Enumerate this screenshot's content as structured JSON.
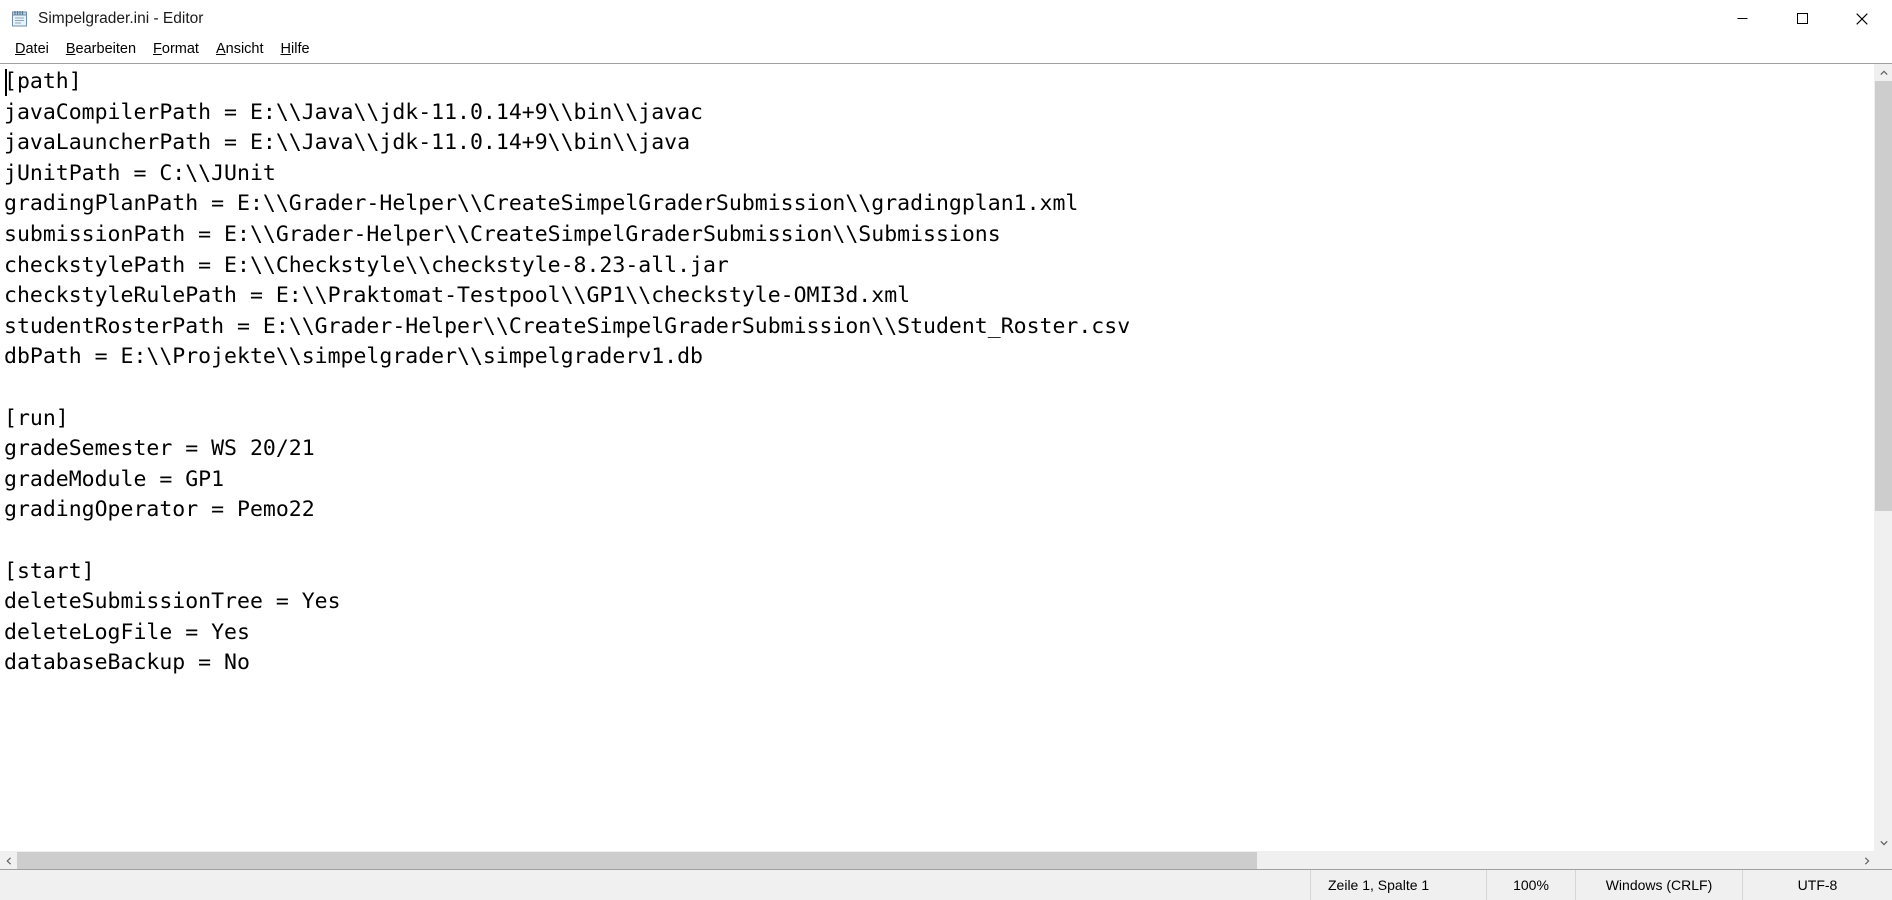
{
  "window": {
    "title": "Simpelgrader.ini - Editor",
    "icon": "notepad-icon",
    "minimize_label": "─",
    "maximize_label": "□",
    "close_label": "✕"
  },
  "menubar": {
    "items": [
      {
        "name": "datei",
        "accel": "D",
        "rest": "atei"
      },
      {
        "name": "bearbeiten",
        "accel": "B",
        "rest": "earbeiten"
      },
      {
        "name": "format",
        "accel": "F",
        "rest": "ormat"
      },
      {
        "name": "ansicht",
        "accel": "A",
        "rest": "nsicht"
      },
      {
        "name": "hilfe",
        "accel": "H",
        "rest": "ilfe"
      }
    ]
  },
  "editor": {
    "content": "[path]\njavaCompilerPath = E:\\\\Java\\\\jdk-11.0.14+9\\\\bin\\\\javac\njavaLauncherPath = E:\\\\Java\\\\jdk-11.0.14+9\\\\bin\\\\java\njUnitPath = C:\\\\JUnit\ngradingPlanPath = E:\\\\Grader-Helper\\\\CreateSimpelGraderSubmission\\\\gradingplan1.xml\nsubmissionPath = E:\\\\Grader-Helper\\\\CreateSimpelGraderSubmission\\\\Submissions\ncheckstylePath = E:\\\\Checkstyle\\\\checkstyle-8.23-all.jar\ncheckstyleRulePath = E:\\\\Praktomat-Testpool\\\\GP1\\\\checkstyle-OMI3d.xml\nstudentRosterPath = E:\\\\Grader-Helper\\\\CreateSimpelGraderSubmission\\\\Student_Roster.csv\ndbPath = E:\\\\Projekte\\\\simpelgrader\\\\simpelgraderv1.db\n\n[run]\ngradeSemester = WS 20/21\ngradeModule = GP1\ngradingOperator = Pemo22\n\n[start]\ndeleteSubmissionTree = Yes\ndeleteLogFile = Yes\ndatabaseBackup = No"
  },
  "scrollbars": {
    "up_arrow": "˄",
    "down_arrow": "˅",
    "left_arrow": "‹",
    "right_arrow": "›"
  },
  "statusbar": {
    "position": "Zeile 1, Spalte 1",
    "zoom": "100%",
    "line_ending": "Windows (CRLF)",
    "encoding": "UTF-8"
  },
  "colors": {
    "window_bg": "#ffffff",
    "statusbar_bg": "#f0f0f0",
    "scrollbar_track": "#f0f0f0",
    "scrollbar_thumb": "#cdcdcd",
    "border": "#a0a0a0",
    "text": "#000000",
    "close_hover": "#e81123"
  }
}
